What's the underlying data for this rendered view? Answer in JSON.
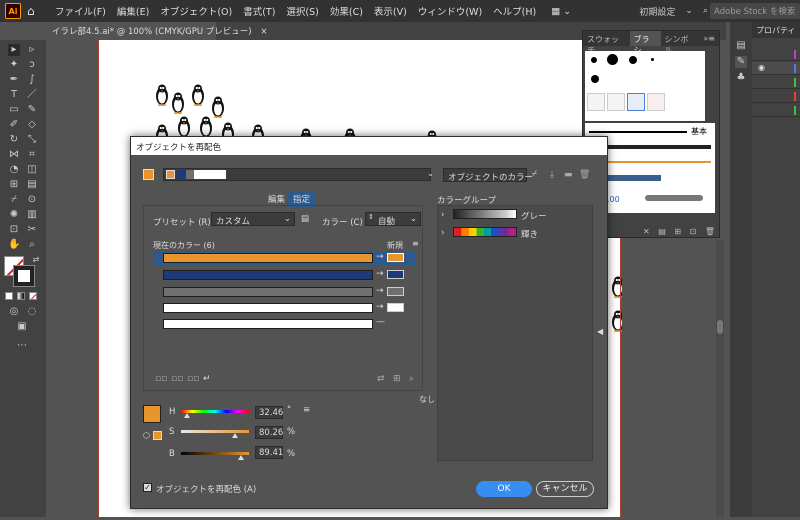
{
  "app": {
    "logo": "Ai"
  },
  "menubar": {
    "items": [
      "ファイル(F)",
      "編集(E)",
      "オブジェクト(O)",
      "書式(T)",
      "選択(S)",
      "効果(C)",
      "表示(V)",
      "ウィンドウ(W)",
      "ヘルプ(H)"
    ],
    "workspace": "初期設定",
    "search_placeholder": "Adobe Stock を検索"
  },
  "document_tab": {
    "title": "イラレ部4.5.ai* @ 100% (CMYK/GPU プレビュー)",
    "close": "×"
  },
  "swatch_panel": {
    "tabs": [
      "スウォッチ",
      "ブラシ",
      "シンボル"
    ],
    "brush_label": "基本",
    "brush_value": ".00"
  },
  "properties_panel": {
    "title": "プロパティ"
  },
  "dialog": {
    "title": "オブジェクトを再配色",
    "color_source": "オブジェクトのカラー",
    "tabs": {
      "edit": "編集",
      "assign": "指定"
    },
    "preset_label": "プリセット (R) :",
    "preset_value": "カスタム",
    "colors_label": "カラー (C) :",
    "colors_value": "自動",
    "current_colors_label": "現在のカラー (6)",
    "new_label": "新規",
    "color_groups_label": "カラーグループ",
    "groups": [
      {
        "name": "グレー"
      },
      {
        "name": "輝き"
      }
    ],
    "none_label": "なし",
    "hsb": {
      "h_label": "H",
      "h_value": "32.46",
      "h_unit": "°",
      "s_label": "S",
      "s_value": "80.26",
      "s_unit": "%",
      "b_label": "B",
      "b_value": "89.41",
      "b_unit": "%"
    },
    "recolor_checkbox": "オブジェクトを再配色 (A)",
    "ok": "OK",
    "cancel": "キャンセル"
  },
  "colors": {
    "orange": "#e8952e",
    "navy": "#1f3a78",
    "gray": "#707070",
    "white": "#ffffff",
    "ok_blue": "#378ef0"
  }
}
